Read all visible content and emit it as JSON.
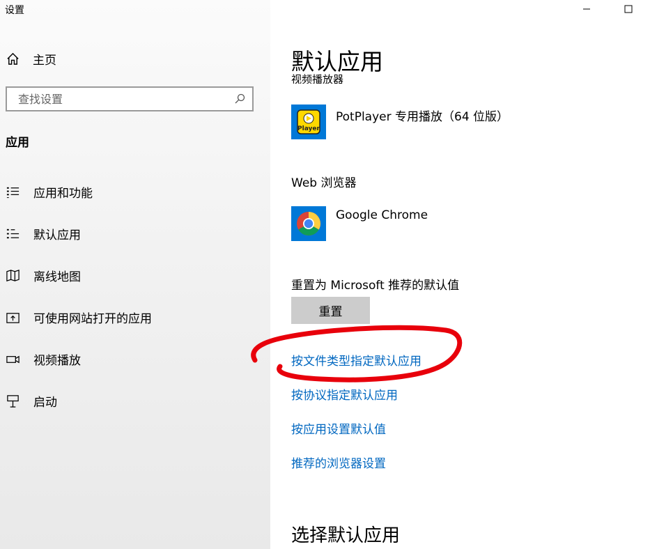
{
  "window": {
    "title": "设置",
    "minimize_glyph": "—",
    "maximize_glyph": "☐"
  },
  "sidebar": {
    "home_label": "主页",
    "search_placeholder": "查找设置",
    "section_title": "应用",
    "items": [
      {
        "label": "应用和功能",
        "icon": "apps-features-icon"
      },
      {
        "label": "默认应用",
        "icon": "default-apps-icon"
      },
      {
        "label": "离线地图",
        "icon": "offline-maps-icon"
      },
      {
        "label": "可使用网站打开的应用",
        "icon": "apps-for-websites-icon"
      },
      {
        "label": "视频播放",
        "icon": "video-playback-icon"
      },
      {
        "label": "启动",
        "icon": "startup-icon"
      }
    ]
  },
  "main": {
    "title": "默认应用",
    "clipped_group_label": "视频播放器",
    "video_player": {
      "app_name": "PotPlayer 专用播放（64 位版）",
      "icon_text": "Player"
    },
    "web_browser": {
      "label": "Web 浏览器",
      "app_name": "Google Chrome"
    },
    "reset": {
      "label": "重置为 Microsoft 推荐的默认值",
      "button_label": "重置"
    },
    "links": [
      "按文件类型指定默认应用",
      "按协议指定默认应用",
      "按应用设置默认值",
      "推荐的浏览器设置"
    ],
    "bottom_title": "选择默认应用"
  },
  "colors": {
    "link": "#0067c0",
    "annotation": "#e8000b",
    "tile_bg": "#0078d7",
    "potplayer_yellow": "#ffd800",
    "reset_button_bg": "#cccccc"
  }
}
